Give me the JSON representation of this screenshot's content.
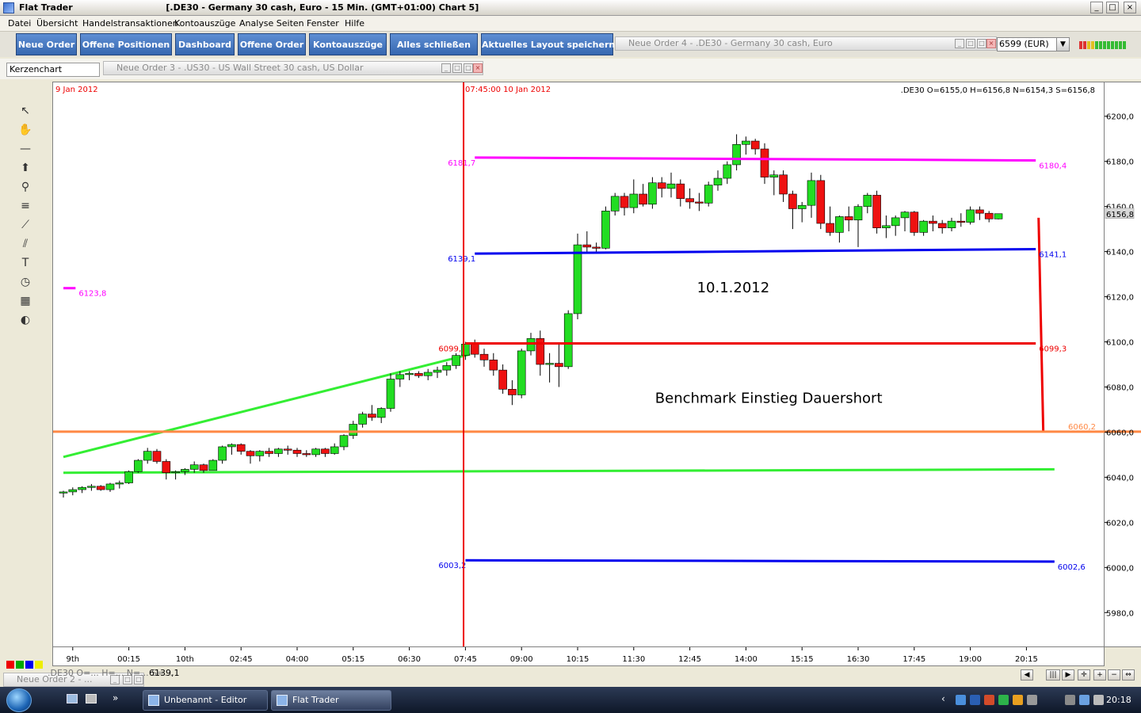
{
  "window": {
    "title": "Flat Trader",
    "chart_title": "[.DE30 - Germany 30 cash, Euro - 15 Min. (GMT+01:00)   Chart 5]",
    "controls": [
      "_",
      "□",
      "×"
    ]
  },
  "menu": [
    "Datei",
    "Übersicht",
    "Handelstransaktionen",
    "Kontoauszüge",
    "Analyse Seiten",
    "Fenster",
    "Hilfe"
  ],
  "toolbar": {
    "buttons": [
      "Neue Order",
      "Offene Positionen",
      "Dashboard",
      "Offene Order",
      "Kontoauszüge",
      "Alles schließen",
      "Aktuelles Layout speichern"
    ],
    "panel_order4": "Neue Order 4 - .DE30 - Germany 30 cash, Euro",
    "account": "6599 (EUR)"
  },
  "chartbar": {
    "chart_type": "Kerzenchart",
    "panel_order3": "Neue Order 3 - .US30 - US Wall Street 30 cash, US Dollar"
  },
  "tools": [
    {
      "name": "cursor-icon",
      "glyph": "↖"
    },
    {
      "name": "hand-icon",
      "glyph": "✋"
    },
    {
      "name": "horizontal-line-icon",
      "glyph": "—"
    },
    {
      "name": "arrow-up-icon",
      "glyph": "⬆"
    },
    {
      "name": "zoom-icon",
      "glyph": "⚲"
    },
    {
      "name": "fibonacci-icon",
      "glyph": "≡"
    },
    {
      "name": "trend-channel-icon",
      "glyph": "⟋"
    },
    {
      "name": "fan-icon",
      "glyph": "⫽"
    },
    {
      "name": "text-icon",
      "glyph": "T"
    },
    {
      "name": "clock-icon",
      "glyph": "◷"
    },
    {
      "name": "calculator-icon",
      "glyph": "▦"
    },
    {
      "name": "paint-icon",
      "glyph": "◐"
    }
  ],
  "colors": {
    "up": "#22dd22",
    "down": "#ee1111",
    "magenta": "#ff00ff",
    "blue": "#0000ee",
    "red": "#ee0000",
    "green": "#33ee33",
    "orange": "#ff8844"
  },
  "chart_data": {
    "type": "candlestick",
    "symbol": ".DE30",
    "ohlc_label": ".DE30 O=6155,0 H=6156,8 N=6154,3 S=6156,8",
    "date_left": "9 Jan 2012",
    "date_cursor": "07:45:00 10 Jan 2012",
    "current_price": "6156,8",
    "ylim": [
      5965,
      6215
    ],
    "y_ticks": [
      "5980,0",
      "6000,0",
      "6020,0",
      "6040,0",
      "6060,0",
      "6080,0",
      "6100,0",
      "6120,0",
      "6140,0",
      "6160,0",
      "6180,0",
      "6200,0"
    ],
    "y_tick_values": [
      5980,
      6000,
      6020,
      6040,
      6060,
      6080,
      6100,
      6120,
      6140,
      6160,
      6180,
      6200
    ],
    "x_ticks": [
      "9th",
      "00:15",
      "10th",
      "02:45",
      "04:00",
      "05:15",
      "06:30",
      "07:45",
      "09:00",
      "10:15",
      "11:30",
      "12:45",
      "14:00",
      "15:15",
      "16:30",
      "17:45",
      "19:00",
      "20:15"
    ],
    "x_tick_bars": [
      1,
      7,
      13,
      19,
      25,
      31,
      37,
      43,
      49,
      55,
      61,
      67,
      73,
      79,
      85,
      91,
      97,
      103
    ],
    "bars": [
      [
        6033,
        6034,
        6031,
        6033.5
      ],
      [
        6033.5,
        6035.5,
        6032,
        6034.5
      ],
      [
        6034.5,
        6036,
        6033,
        6035.5
      ],
      [
        6035.5,
        6037,
        6034,
        6036
      ],
      [
        6036,
        6036.5,
        6034,
        6034.5
      ],
      [
        6034.5,
        6037.5,
        6033.5,
        6037
      ],
      [
        6037,
        6038.5,
        6035,
        6037.5
      ],
      [
        6037.5,
        6043,
        6037,
        6042.5
      ],
      [
        6042.5,
        6048,
        6042,
        6047.5
      ],
      [
        6047.5,
        6053,
        6046,
        6051.5
      ],
      [
        6051.5,
        6052.5,
        6046,
        6047
      ],
      [
        6047,
        6048,
        6039,
        6042
      ],
      [
        6042,
        6043,
        6039,
        6042.5
      ],
      [
        6042.5,
        6044,
        6041,
        6043.5
      ],
      [
        6043.5,
        6047,
        6042,
        6045.5
      ],
      [
        6045.5,
        6046,
        6042,
        6043
      ],
      [
        6043,
        6048,
        6043,
        6047.5
      ],
      [
        6047.5,
        6054,
        6046,
        6053.5
      ],
      [
        6053.5,
        6055,
        6050,
        6054.5
      ],
      [
        6054.5,
        6055,
        6050,
        6051.5
      ],
      [
        6051.5,
        6052,
        6046,
        6049.5
      ],
      [
        6049.5,
        6052,
        6047,
        6051.5
      ],
      [
        6051.5,
        6053,
        6049,
        6050.5
      ],
      [
        6050.5,
        6053,
        6049,
        6052.5
      ],
      [
        6052.5,
        6054,
        6050,
        6052
      ],
      [
        6052,
        6053,
        6049,
        6050.5
      ],
      [
        6050.5,
        6052,
        6049,
        6050
      ],
      [
        6050,
        6053,
        6049,
        6052.5
      ],
      [
        6052.5,
        6053,
        6049,
        6050.5
      ],
      [
        6050.5,
        6055,
        6050,
        6053.5
      ],
      [
        6053.5,
        6059,
        6052,
        6058.5
      ],
      [
        6058.5,
        6065,
        6057,
        6063.5
      ],
      [
        6063.5,
        6069,
        6062,
        6068
      ],
      [
        6068,
        6072,
        6065,
        6066.5
      ],
      [
        6066.5,
        6071,
        6064,
        6070.5
      ],
      [
        6070.5,
        6086,
        6069,
        6083.5
      ],
      [
        6083.5,
        6087,
        6080,
        6085.5
      ],
      [
        6085.5,
        6087,
        6083,
        6086
      ],
      [
        6086,
        6087,
        6084,
        6085
      ],
      [
        6085,
        6088,
        6083,
        6086.5
      ],
      [
        6086.5,
        6089,
        6084,
        6087.5
      ],
      [
        6087.5,
        6091,
        6085,
        6089.5
      ],
      [
        6089.5,
        6095,
        6088,
        6094
      ],
      [
        6094,
        6100,
        6092,
        6099
      ],
      [
        6099,
        6101,
        6093,
        6094.5
      ],
      [
        6094.5,
        6097,
        6089,
        6092
      ],
      [
        6092,
        6095,
        6085,
        6087.5
      ],
      [
        6087.5,
        6090,
        6077,
        6079
      ],
      [
        6079,
        6083,
        6072,
        6076.5
      ],
      [
        6076.5,
        6097,
        6075,
        6096
      ],
      [
        6096,
        6104,
        6094,
        6101.5
      ],
      [
        6101.5,
        6105,
        6085,
        6090
      ],
      [
        6090,
        6095,
        6082,
        6090.5
      ],
      [
        6090.5,
        6099,
        6080,
        6089
      ],
      [
        6089,
        6114,
        6088,
        6112.5
      ],
      [
        6112.5,
        6148,
        6110,
        6143
      ],
      [
        6143,
        6149,
        6139,
        6142
      ],
      [
        6142,
        6144,
        6140,
        6141.5
      ],
      [
        6141.5,
        6160,
        6141,
        6158
      ],
      [
        6158,
        6166,
        6156,
        6164.5
      ],
      [
        6164.5,
        6166,
        6156,
        6159.5
      ],
      [
        6159.5,
        6172,
        6157,
        6165.5
      ],
      [
        6165.5,
        6170,
        6160,
        6161
      ],
      [
        6161,
        6173,
        6159,
        6170.5
      ],
      [
        6170.5,
        6173,
        6164,
        6168
      ],
      [
        6168,
        6175,
        6164,
        6170
      ],
      [
        6170,
        6172,
        6160,
        6163.5
      ],
      [
        6163.5,
        6168,
        6159,
        6162
      ],
      [
        6162,
        6166,
        6158,
        6161.5
      ],
      [
        6161.5,
        6171,
        6160,
        6169.5
      ],
      [
        6169.5,
        6176,
        6167,
        6172.5
      ],
      [
        6172.5,
        6180,
        6170,
        6178.5
      ],
      [
        6178.5,
        6192,
        6176,
        6187.5
      ],
      [
        6187.5,
        6191,
        6183,
        6189
      ],
      [
        6189,
        6190,
        6183,
        6185.5
      ],
      [
        6185.5,
        6188,
        6170,
        6173
      ],
      [
        6173,
        6176,
        6165,
        6174
      ],
      [
        6174,
        6176,
        6162,
        6165.5
      ],
      [
        6165.5,
        6167,
        6150,
        6159
      ],
      [
        6159,
        6162,
        6153,
        6160.5
      ],
      [
        6160.5,
        6175,
        6155,
        6171.5
      ],
      [
        6171.5,
        6174,
        6150,
        6152.5
      ],
      [
        6152.5,
        6160,
        6147,
        6148.5
      ],
      [
        6148.5,
        6156,
        6144,
        6155.5
      ],
      [
        6155.5,
        6160,
        6149,
        6154
      ],
      [
        6154,
        6161,
        6142,
        6160
      ],
      [
        6160,
        6166,
        6157,
        6165
      ],
      [
        6165,
        6167,
        6148,
        6150.5
      ],
      [
        6150.5,
        6156,
        6146,
        6151.5
      ],
      [
        6151.5,
        6156,
        6147,
        6155
      ],
      [
        6155,
        6158,
        6149,
        6157.5
      ],
      [
        6157.5,
        6158,
        6147,
        6148.5
      ],
      [
        6148.5,
        6154,
        6147,
        6153.5
      ],
      [
        6153.5,
        6156,
        6149,
        6152.5
      ],
      [
        6152.5,
        6154,
        6148,
        6150.5
      ],
      [
        6150.5,
        6155,
        6149,
        6153.5
      ],
      [
        6153.5,
        6157,
        6151,
        6153
      ],
      [
        6153,
        6160,
        6152,
        6158.5
      ],
      [
        6158.5,
        6160,
        6154,
        6157
      ],
      [
        6157,
        6158,
        6153,
        6154.5
      ],
      [
        6154.5,
        6156.8,
        6154.3,
        6156.8
      ]
    ],
    "levels": [
      {
        "name": "level-6181-7",
        "label_left": "6181,7",
        "label_right": "6180,4",
        "from_bar": 44,
        "to_bar": 104,
        "y1": 6181.7,
        "y2": 6180.4,
        "color": "#ff00ff"
      },
      {
        "name": "level-6139-1",
        "label_left": "6139,1",
        "label_right": "6141,1",
        "from_bar": 44,
        "to_bar": 104,
        "y1": 6139.1,
        "y2": 6141.1,
        "color": "#0000ee"
      },
      {
        "name": "level-6099",
        "label_left": "6099,",
        "label_right": "6099,3",
        "from_bar": 43,
        "to_bar": 104,
        "y1": 6099.3,
        "y2": 6099.3,
        "color": "#ee0000"
      },
      {
        "name": "level-6003-2",
        "label_left": "6003,2",
        "label_right": "6002,6",
        "from_bar": 43,
        "to_bar": 106,
        "y1": 6003.2,
        "y2": 6002.6,
        "color": "#0000ee"
      },
      {
        "name": "level-6123-8",
        "label_left": "",
        "label_right": "6123,8",
        "from_bar": 0,
        "to_bar": 1.3,
        "y1": 6123.8,
        "y2": 6123.8,
        "color": "#ff00ff"
      }
    ],
    "trendlines": [
      {
        "name": "green-rising-trendline",
        "from_bar": 0,
        "to_bar": 43.5,
        "y1": 6049,
        "y2": 6094.5,
        "color": "#33ee33"
      },
      {
        "name": "green-support-line",
        "from_bar": 0,
        "to_bar": 106,
        "y1": 6042,
        "y2": 6043.5,
        "color": "#33ee33"
      },
      {
        "name": "red-drop-line",
        "from_bar": 104.3,
        "to_bar": 104.8,
        "y1": 6155,
        "y2": 6060.5,
        "color": "#ee0000"
      }
    ],
    "hlines": [
      {
        "name": "orange-line-6060",
        "y": 6060.2,
        "label": "6060,2",
        "color": "#ff8844"
      }
    ],
    "vlines": [
      {
        "name": "cursor-vertical-line",
        "bar": 42.8,
        "color": "#ee0000"
      }
    ],
    "annotations": [
      "10.1.2012",
      "Benchmark Einstieg Dauershort"
    ],
    "annotation_positions": [
      {
        "bar": 72,
        "y": 6122
      },
      {
        "bar": 76,
        "y": 6073
      }
    ]
  },
  "bottom": {
    "panel_order2": "Neue Order 2 - ...",
    "status_text": ".DE30 O=... H=... N=... S=...",
    "status_value": "6139,1"
  },
  "taskbar": {
    "tasks": [
      "Unbenannt - Editor",
      "Flat Trader"
    ],
    "clock": "20:18"
  }
}
